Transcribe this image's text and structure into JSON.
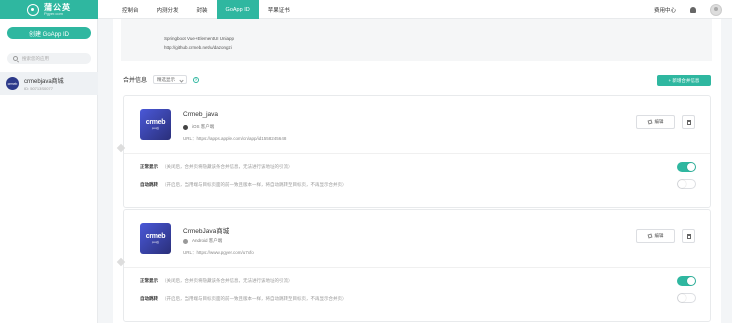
{
  "brand": {
    "name": "蒲公英",
    "sub": "Pgyer.com"
  },
  "nav": [
    {
      "label": "控制台"
    },
    {
      "label": "内测分发"
    },
    {
      "label": "封装"
    },
    {
      "label": "GoApp ID",
      "active": true
    },
    {
      "label": "苹果证书"
    }
  ],
  "top_right": {
    "fee_center": "费用中心"
  },
  "sidebar": {
    "create_label": "创建 GoApp ID",
    "search_placeholder": "搜索您的应用",
    "app": {
      "avatar": "crmeb",
      "name": "crmebjava商城",
      "id": "ID: 50713S0077"
    }
  },
  "info_box": {
    "line1": "Springboot Vue+ElementUI Uniapp",
    "line2": "http://github.crmeb.net/u/dazongzi"
  },
  "section": {
    "title": "合并信息",
    "select_value": "精选显示",
    "help": "?",
    "add_label": "+ 新增合并信息"
  },
  "cards": [
    {
      "thumb_word": "crmeb",
      "thumb_sub": "java版",
      "name": "Crmeb_java",
      "platform": "iOS 客户端",
      "url": "URL：https://apps.apple.com/cn/app/id1558245648",
      "edit_label": "编辑",
      "rows": [
        {
          "key": "正常显示",
          "desc": "（关闭后，合并页将隐藏该条合并信息，无法进行该地址的引流）",
          "on": true
        },
        {
          "key": "自动跳转",
          "desc": "（开启后，当用端与目标页面的前一致且版本一样，将自动跳转至目标页，不再显示合并页）",
          "on": false
        }
      ]
    },
    {
      "thumb_word": "crmeb",
      "thumb_sub": "java版",
      "name": "CrmebJava商城",
      "platform": "Android 客户端",
      "url": "URL：https://www.pgyer.com/u7xfo",
      "edit_label": "编辑",
      "rows": [
        {
          "key": "正常显示",
          "desc": "（关闭后，合并页将隐藏该条合并信息，无法进行该地址的引流）",
          "on": true
        },
        {
          "key": "自动跳转",
          "desc": "（开启后，当用端与目标页面的前一致且版本一样，将自动跳转至目标页，不再显示合并页）",
          "on": false
        }
      ]
    }
  ],
  "colors": {
    "accent": "#2fb7a0"
  }
}
